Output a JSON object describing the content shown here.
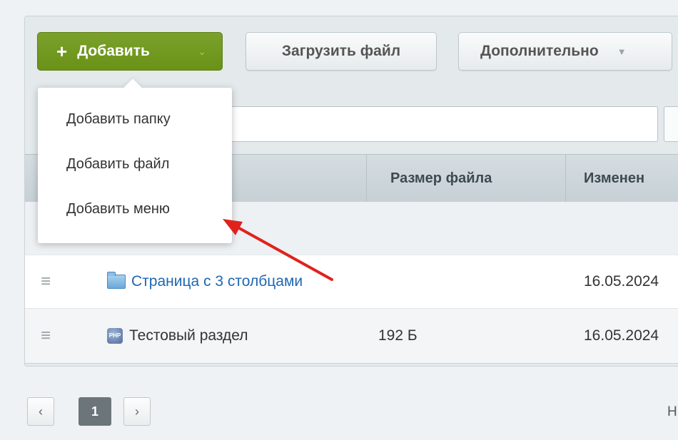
{
  "toolbar": {
    "add_label": "Добавить",
    "upload_label": "Загрузить файл",
    "more_label": "Дополнительно"
  },
  "dropdown": {
    "items": [
      "Добавить папку",
      "Добавить файл",
      "Добавить меню"
    ]
  },
  "search": {
    "value_fragment": "|"
  },
  "table": {
    "columns": [
      "Размер файла",
      "Изменен"
    ],
    "rows": [
      {
        "name": "Страница с 3 столбцами",
        "type": "folder",
        "size": "",
        "date": "16.05.2024"
      },
      {
        "name": "Тестовый раздел",
        "type": "php",
        "size": "192 Б",
        "date": "16.05.2024"
      }
    ]
  },
  "pagination": {
    "prev": "‹",
    "current": "1",
    "next": "›",
    "trailing_text": "Н"
  },
  "icons": {
    "plus": "plus-icon",
    "hamburger": "hamburger-icon",
    "folder": "folder-icon",
    "php_file": "php-file-icon",
    "arrow": "annotation-arrow"
  },
  "colors": {
    "add_button": "#6a9217",
    "link": "#2067b0",
    "arrow": "#e0221c"
  }
}
